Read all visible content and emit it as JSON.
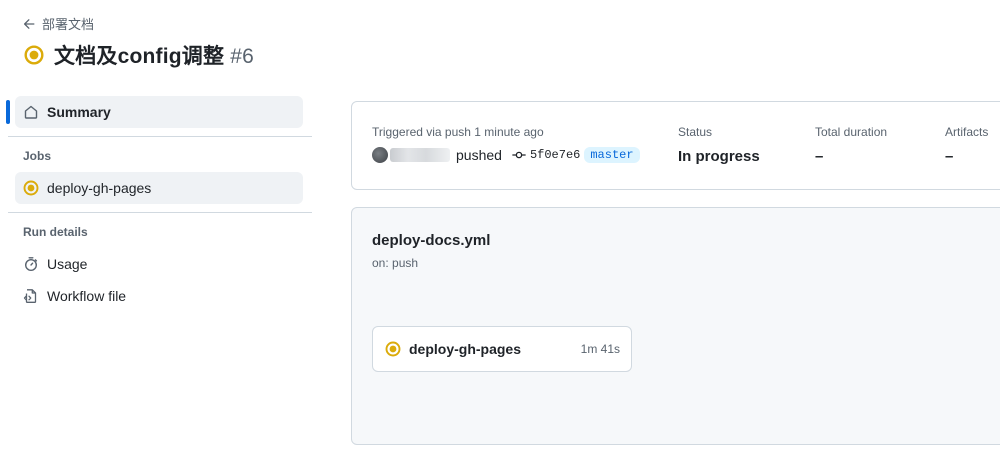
{
  "header": {
    "back_label": "部署文档",
    "run_title": "文档及config调整",
    "run_number": "#6"
  },
  "sidebar": {
    "summary_label": "Summary",
    "jobs_heading": "Jobs",
    "jobs": [
      {
        "label": "deploy-gh-pages",
        "status": "in_progress"
      }
    ],
    "run_details_heading": "Run details",
    "details": [
      {
        "label": "Usage",
        "icon": "stopwatch-icon"
      },
      {
        "label": "Workflow file",
        "icon": "file-code-icon"
      }
    ]
  },
  "summary": {
    "trigger_label": "Triggered via push 1 minute ago",
    "pushed_text": "pushed",
    "commit_sha": "5f0e7e6",
    "branch": "master",
    "status_label": "Status",
    "status_value": "In progress",
    "duration_label": "Total duration",
    "duration_value": "–",
    "artifacts_label": "Artifacts",
    "artifacts_value": "–"
  },
  "workflow": {
    "file_name": "deploy-docs.yml",
    "trigger": "on: push",
    "job": {
      "name": "deploy-gh-pages",
      "duration": "1m 41s"
    }
  },
  "colors": {
    "in_progress": "#dbab0a",
    "accent": "#0969da",
    "border": "#d1d9e0"
  }
}
